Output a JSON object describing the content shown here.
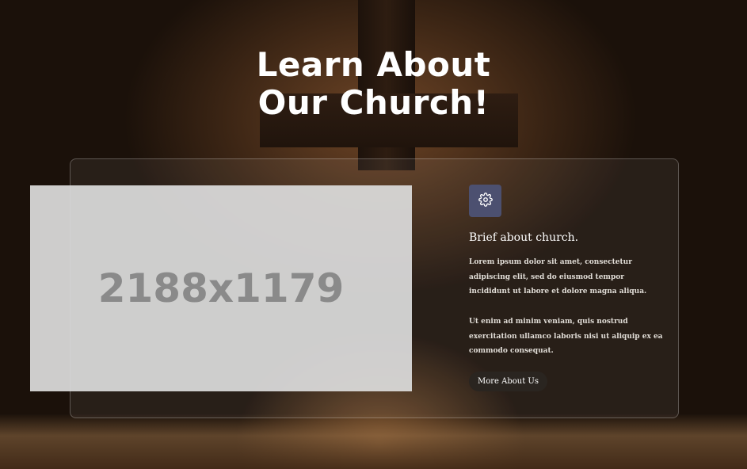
{
  "hero": {
    "title_line1": "Learn About",
    "title_line2": "Our Church!"
  },
  "card": {
    "image_placeholder": "2188x1179",
    "icon": "gear-icon",
    "heading": "Brief about church.",
    "paragraph1": "Lorem ipsum dolor sit amet, consectetur adipiscing elit, sed do eiusmod tempor incididunt ut labore et dolore magna aliqua.",
    "paragraph2": "Ut enim ad minim veniam, quis nostrud exercitation ullamco laboris nisi ut aliquip ex ea commodo consequat.",
    "button_label": "More About Us"
  },
  "colors": {
    "icon_box": "#4c5070",
    "button_bg": "#2a2520"
  }
}
